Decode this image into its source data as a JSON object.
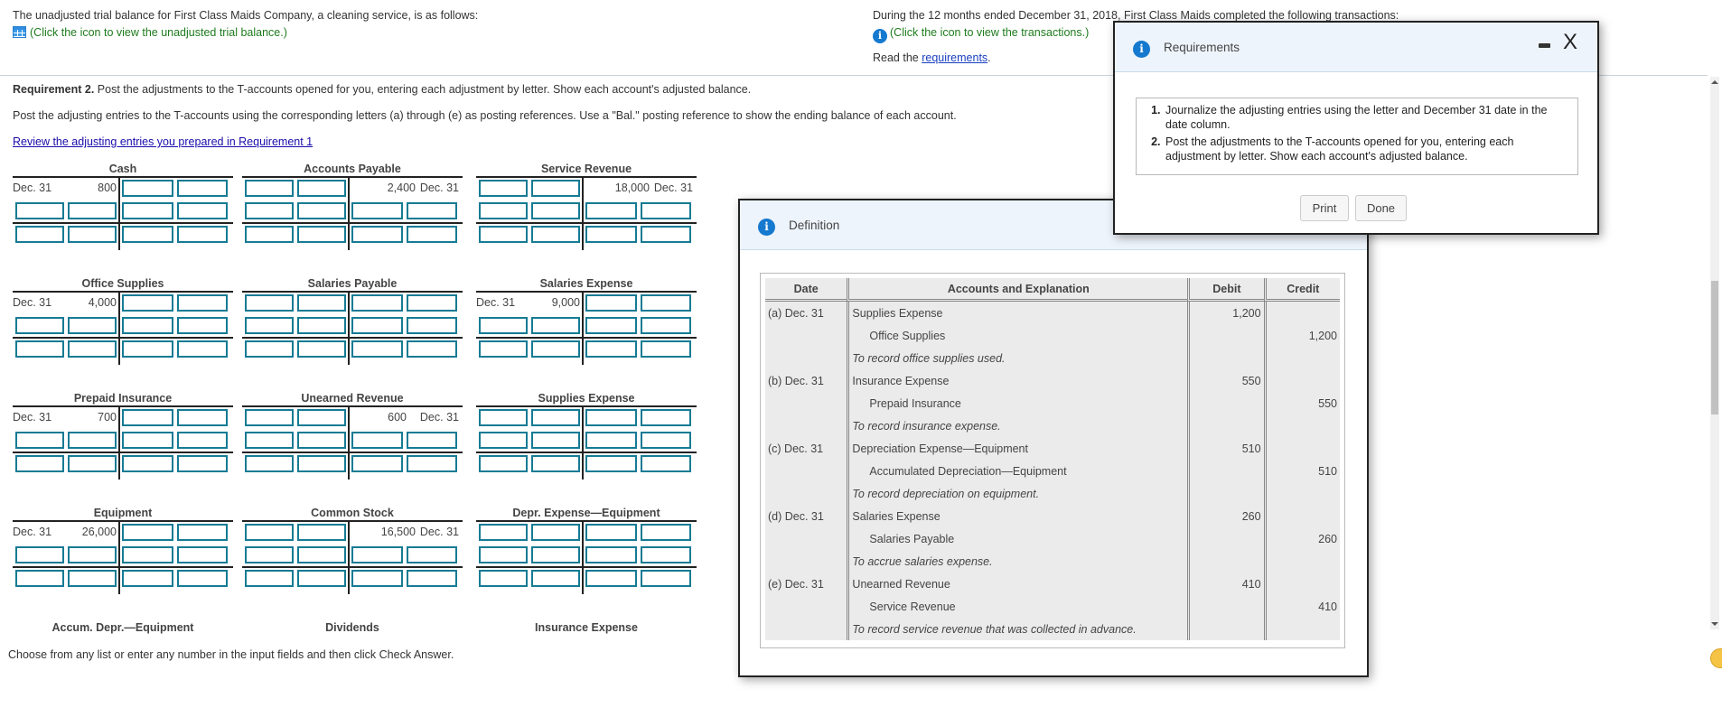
{
  "problem": {
    "trial_balance_text": "The unadjusted trial balance for First Class Maids Company, a cleaning service, is as follows:",
    "trial_balance_link": "(Click the icon to view the unadjusted trial balance.)",
    "transactions_text": "During the 12 months ended December 31, 2018, First Class Maids completed the following transactions:",
    "transactions_link": "(Click the icon to view the transactions.)",
    "read_prefix": "Read the ",
    "requirements_link": "requirements",
    "read_suffix": "."
  },
  "requirement2": {
    "label": "Requirement 2.",
    "text": " Post the adjustments to the T-accounts opened for you, entering each adjustment by letter. Show each account's adjusted balance.",
    "instruction": "Post the adjusting entries to the T-accounts using the corresponding letters (a) through (e) as posting references. Use a \"Bal.\" posting reference to show the ending balance of each account.",
    "review_link": "Review the adjusting entries you prepared in Requirement 1"
  },
  "t_accounts": [
    {
      "title": "Cash",
      "side": "debit",
      "date": "Dec. 31",
      "amount": "800"
    },
    {
      "title": "Accounts Payable",
      "side": "credit",
      "date": "Dec. 31",
      "amount": "2,400"
    },
    {
      "title": "Service Revenue",
      "side": "credit",
      "date": "Dec. 31",
      "amount": "18,000"
    },
    {
      "title": "Office Supplies",
      "side": "debit",
      "date": "Dec. 31",
      "amount": "4,000"
    },
    {
      "title": "Salaries Payable",
      "side": "none",
      "date": "",
      "amount": ""
    },
    {
      "title": "Salaries Expense",
      "side": "debit",
      "date": "Dec. 31",
      "amount": "9,000"
    },
    {
      "title": "Prepaid Insurance",
      "side": "debit",
      "date": "Dec. 31",
      "amount": "700"
    },
    {
      "title": "Unearned Revenue",
      "side": "credit",
      "date": "Dec. 31",
      "amount": "600"
    },
    {
      "title": "Supplies Expense",
      "side": "none",
      "date": "",
      "amount": ""
    },
    {
      "title": "Equipment",
      "side": "debit",
      "date": "Dec. 31",
      "amount": "26,000"
    },
    {
      "title": "Common Stock",
      "side": "credit",
      "date": "Dec. 31",
      "amount": "16,500"
    },
    {
      "title": "Depr. Expense—Equipment",
      "side": "none",
      "date": "",
      "amount": ""
    },
    {
      "title": "Accum. Depr.—Equipment",
      "side": "none",
      "date": "",
      "amount": ""
    },
    {
      "title": "Dividends",
      "side": "none",
      "date": "",
      "amount": ""
    },
    {
      "title": "Insurance Expense",
      "side": "none",
      "date": "",
      "amount": ""
    }
  ],
  "footer_text": "Choose from any list or enter any number in the input fields and then click Check Answer.",
  "requirements_modal": {
    "title": "Requirements",
    "items": [
      "Journalize the adjusting entries using the letter and December 31 date in the date column.",
      "Post the adjustments to the T-accounts opened for you, entering each adjustment by letter. Show each account's adjusted balance."
    ],
    "print_label": "Print",
    "done_label": "Done",
    "minimize_icon": "minimize-icon",
    "close_label": "X"
  },
  "definition_modal": {
    "title": "Definition",
    "headers": {
      "date": "Date",
      "accounts": "Accounts and Explanation",
      "debit": "Debit",
      "credit": "Credit"
    },
    "rows": [
      {
        "date": "(a) Dec. 31",
        "account": "Supplies Expense",
        "type": "debit",
        "debit": "1,200",
        "credit": ""
      },
      {
        "date": "",
        "account": "Office Supplies",
        "type": "credit",
        "debit": "",
        "credit": "1,200"
      },
      {
        "date": "",
        "account": "To record office supplies used.",
        "type": "explanation",
        "debit": "",
        "credit": ""
      },
      {
        "date": "(b) Dec. 31",
        "account": "Insurance Expense",
        "type": "debit",
        "debit": "550",
        "credit": ""
      },
      {
        "date": "",
        "account": "Prepaid Insurance",
        "type": "credit",
        "debit": "",
        "credit": "550"
      },
      {
        "date": "",
        "account": "To record insurance expense.",
        "type": "explanation",
        "debit": "",
        "credit": ""
      },
      {
        "date": "(c) Dec. 31",
        "account": "Depreciation Expense—Equipment",
        "type": "debit",
        "debit": "510",
        "credit": ""
      },
      {
        "date": "",
        "account": "Accumulated Depreciation—Equipment",
        "type": "credit",
        "debit": "",
        "credit": "510"
      },
      {
        "date": "",
        "account": "To record depreciation on equipment.",
        "type": "explanation",
        "debit": "",
        "credit": ""
      },
      {
        "date": "(d) Dec. 31",
        "account": "Salaries Expense",
        "type": "debit",
        "debit": "260",
        "credit": ""
      },
      {
        "date": "",
        "account": "Salaries Payable",
        "type": "credit",
        "debit": "",
        "credit": "260"
      },
      {
        "date": "",
        "account": "To accrue salaries expense.",
        "type": "explanation",
        "debit": "",
        "credit": ""
      },
      {
        "date": "(e) Dec. 31",
        "account": "Unearned Revenue",
        "type": "debit",
        "debit": "410",
        "credit": ""
      },
      {
        "date": "",
        "account": "Service Revenue",
        "type": "credit",
        "debit": "",
        "credit": "410"
      },
      {
        "date": "",
        "account": "To record service revenue that was collected in advance.",
        "type": "explanation",
        "debit": "",
        "credit": ""
      }
    ]
  },
  "colors": {
    "input_border": "#167b94",
    "info_blue": "#1579cf",
    "link_green": "#1e7b1e",
    "modal_header": "#eef4fb",
    "table_bg": "#ebebeb"
  }
}
